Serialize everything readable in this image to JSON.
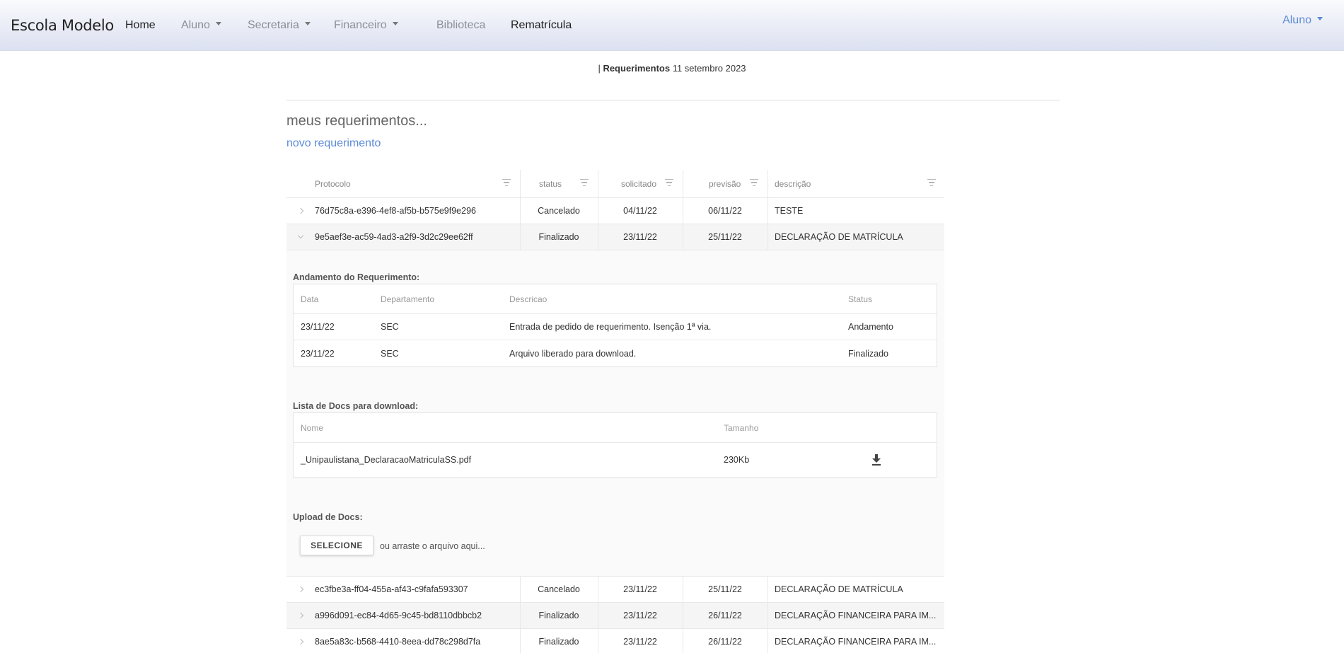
{
  "navbar": {
    "brand": "Escola Modelo",
    "items": [
      {
        "label": "Home",
        "active": true,
        "dropdown": false
      },
      {
        "label": "Aluno",
        "active": false,
        "dropdown": true
      },
      {
        "label": "Secretaria",
        "active": false,
        "dropdown": true
      },
      {
        "label": "Financeiro",
        "active": false,
        "dropdown": true
      },
      {
        "label": "Biblioteca",
        "active": false,
        "dropdown": false
      },
      {
        "label": "Rematrícula",
        "active": true,
        "dropdown": false
      }
    ],
    "user": "Aluno"
  },
  "header": {
    "prefix": "| ",
    "section": "Requerimentos",
    "date": "11 setembro 2023"
  },
  "page": {
    "title": "meus requerimentos...",
    "new_link": "novo requerimento"
  },
  "table": {
    "columns": {
      "protocolo": "Protocolo",
      "status": "status",
      "solicitado": "solicitado",
      "previsao": "previsão",
      "descricao": "descrição"
    },
    "rows": [
      {
        "protocolo": "76d75c8a-e396-4ef8-af5b-b575e9f9e296",
        "status": "Cancelado",
        "solicitado": "04/11/22",
        "previsao": "06/11/22",
        "descricao": "TESTE"
      },
      {
        "protocolo": "9e5aef3e-ac59-4ad3-a2f9-3d2c29ee62ff",
        "status": "Finalizado",
        "solicitado": "23/11/22",
        "previsao": "25/11/22",
        "descricao": "DECLARAÇÃO DE MATRÍCULA"
      },
      {
        "protocolo": "ec3fbe3a-ff04-455a-af43-c9fafa593307",
        "status": "Cancelado",
        "solicitado": "23/11/22",
        "previsao": "25/11/22",
        "descricao": "DECLARAÇÃO DE MATRÍCULA"
      },
      {
        "protocolo": "a996d091-ec84-4d65-9c45-bd8110dbbcb2",
        "status": "Finalizado",
        "solicitado": "23/11/22",
        "previsao": "26/11/22",
        "descricao": "DECLARAÇÃO FINANCEIRA PARA IM..."
      },
      {
        "protocolo": "8ae5a83c-b568-4410-8eea-dd78c298d7fa",
        "status": "Finalizado",
        "solicitado": "23/11/22",
        "previsao": "26/11/22",
        "descricao": "DECLARAÇÃO FINANCEIRA PARA IM..."
      }
    ]
  },
  "details": {
    "andamento_title": "Andamento do Requerimento:",
    "andamento_columns": {
      "data": "Data",
      "departamento": "Departamento",
      "descricao": "Descricao",
      "status": "Status"
    },
    "andamento_rows": [
      {
        "data": "23/11/22",
        "departamento": "SEC",
        "descricao": "Entrada de pedido de requerimento. Isenção 1ª via.",
        "status": "Andamento"
      },
      {
        "data": "23/11/22",
        "departamento": "SEC",
        "descricao": "Arquivo liberado para download.",
        "status": "Finalizado"
      }
    ],
    "docs_title": "Lista de Docs para download:",
    "docs_columns": {
      "nome": "Nome",
      "tamanho": "Tamanho"
    },
    "docs_rows": [
      {
        "nome": "_Unipaulistana_DeclaracaoMatriculaSS.pdf",
        "tamanho": "230Kb",
        "icon": "download-icon"
      }
    ],
    "upload_title": "Upload de Docs:",
    "upload_button": "SELECIONE",
    "upload_hint": "ou arraste o arquivo aqui..."
  }
}
